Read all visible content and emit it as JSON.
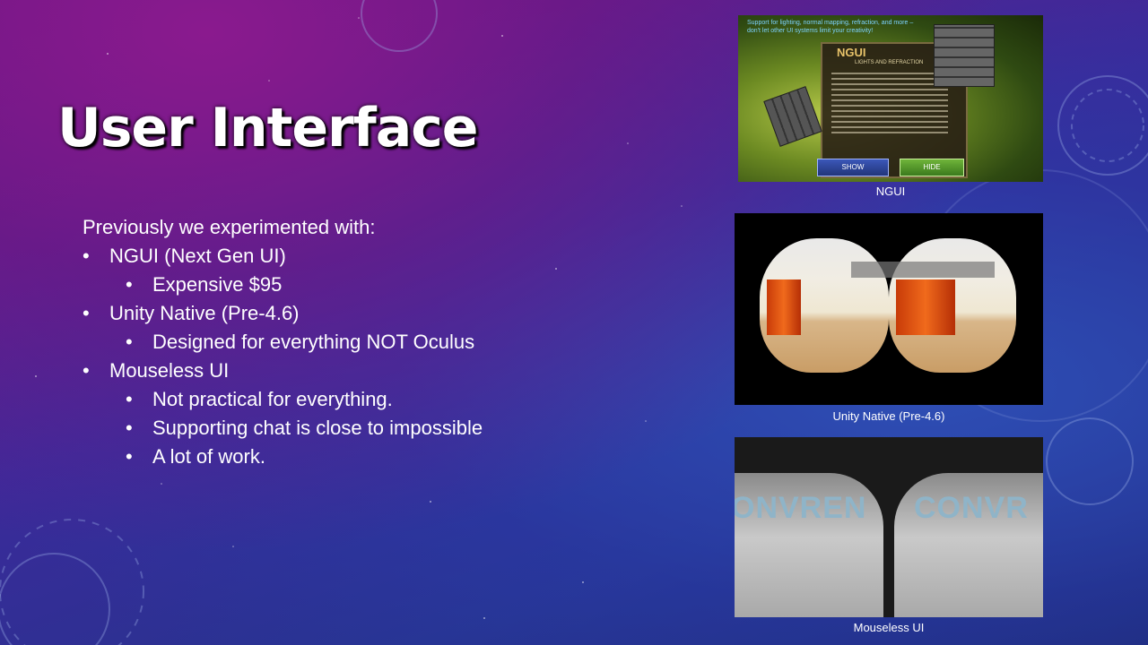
{
  "slide": {
    "title": "User Interface",
    "lead": "Previously we experimented with:",
    "bullets": [
      {
        "text": "NGUI (Next Gen UI)",
        "sub": [
          "Expensive $95"
        ]
      },
      {
        "text": "Unity Native (Pre-4.6)",
        "sub": [
          "Designed for everything NOT Oculus"
        ]
      },
      {
        "text": "Mouseless UI",
        "sub": [
          "Not practical for everything.",
          "Supporting chat is close to impossible",
          "A lot of work."
        ]
      }
    ]
  },
  "images": {
    "ngui": {
      "caption": "NGUI",
      "intro": "Support for lighting, normal mapping, refraction, and more – don't let other UI systems limit your creativity!",
      "logo": "NGUI",
      "dialog_title": "LIGHTS AND REFRACTION",
      "show_label": "SHOW",
      "hide_label": "HIDE"
    },
    "unity": {
      "caption": "Unity Native (Pre-4.6)"
    },
    "mouseless": {
      "caption": "Mouseless UI",
      "banner_left": "ONVREN",
      "banner_right": "CONVR"
    }
  },
  "colors": {
    "title_text": "#ffffff",
    "bg_purple": "#6a1a8a",
    "bg_blue": "#27338f"
  }
}
